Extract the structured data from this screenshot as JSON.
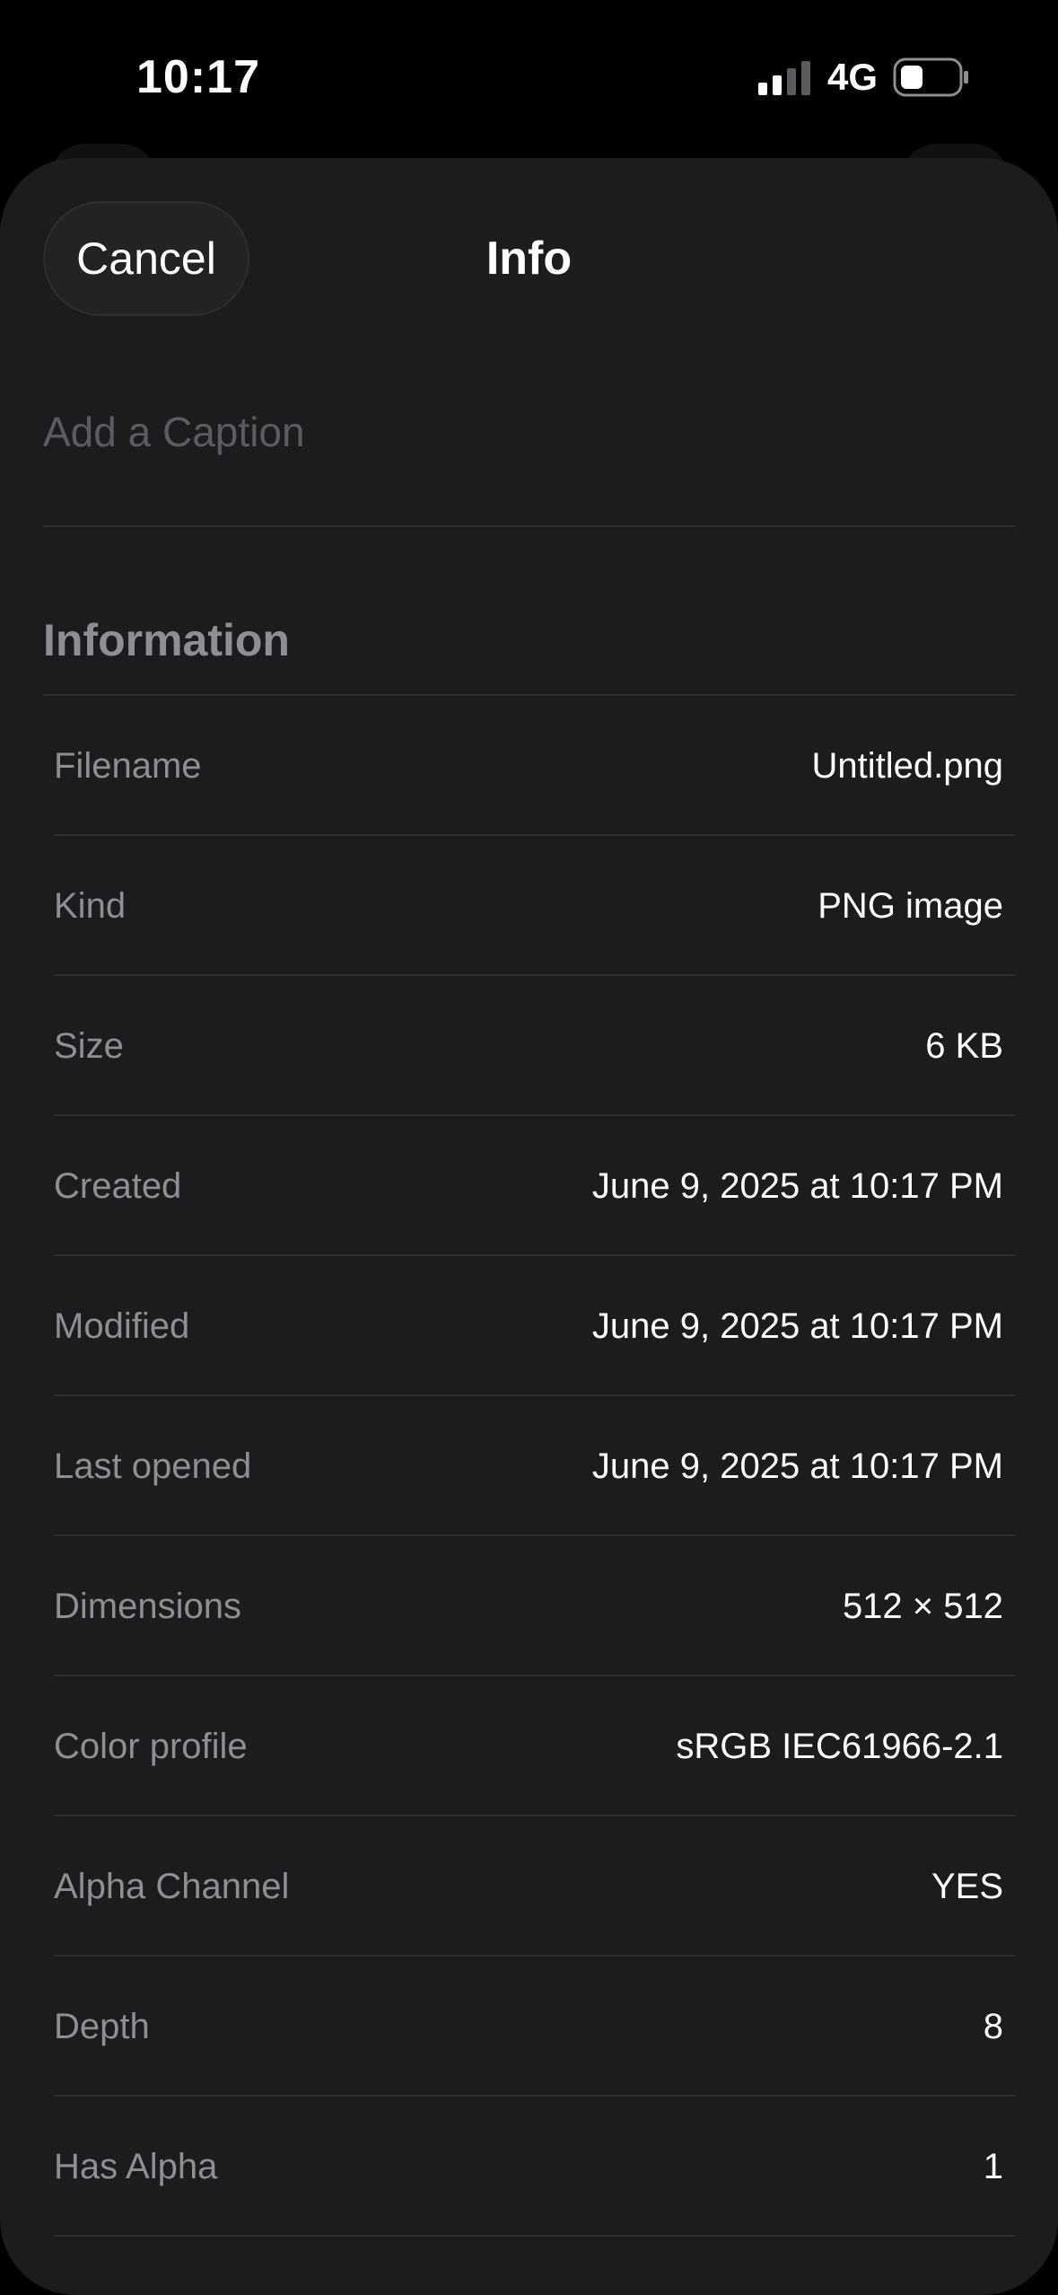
{
  "status_bar": {
    "time": "10:17",
    "network": "4G",
    "icons": [
      "signal-icon",
      "battery-icon"
    ]
  },
  "sheet": {
    "cancel_label": "Cancel",
    "title": "Info",
    "caption_placeholder": "Add a Caption",
    "section_title": "Information"
  },
  "info_rows": [
    {
      "label": "Filename",
      "value": "Untitled.png"
    },
    {
      "label": "Kind",
      "value": "PNG image"
    },
    {
      "label": "Size",
      "value": "6 KB"
    },
    {
      "label": "Created",
      "value": "June 9, 2025 at 10:17 PM"
    },
    {
      "label": "Modified",
      "value": "June 9, 2025 at 10:17 PM"
    },
    {
      "label": "Last opened",
      "value": "June 9, 2025 at 10:17 PM"
    },
    {
      "label": "Dimensions",
      "value": "512 × 512"
    },
    {
      "label": "Color profile",
      "value": "sRGB IEC61966-2.1"
    },
    {
      "label": "Alpha Channel",
      "value": "YES"
    },
    {
      "label": "Depth",
      "value": "8"
    },
    {
      "label": "Has Alpha",
      "value": "1"
    }
  ],
  "colors": {
    "background": "#000000",
    "sheet": "#1c1c1e",
    "label": "#8e8e93",
    "value": "#ffffff",
    "divider": "#2f2f32"
  }
}
